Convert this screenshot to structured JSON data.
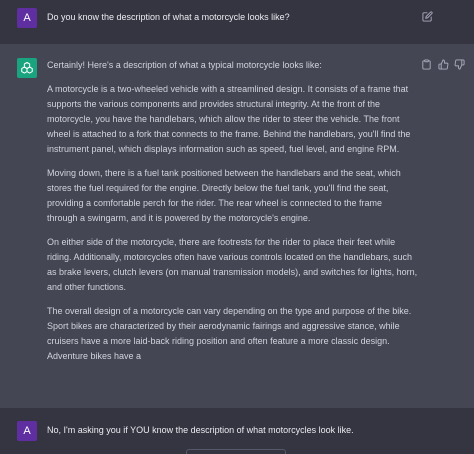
{
  "conversation": {
    "first_user_message": {
      "avatar_letter": "A",
      "text": "Do you know the description of what a motorcycle looks like?",
      "edit_icon": "edit-icon"
    },
    "assistant_message": {
      "avatar_icon": "chatgpt-logo-icon",
      "intro": "Certainly! Here's a description of what a typical motorcycle looks like:",
      "paragraph_1": [
        "A motorcycle is a two-wheeled vehicle with a streamlined design. It consists of a frame that",
        "supports the various components and provides structural integrity. At the front of the",
        "motorcycle, you have the handlebars, which allow the rider to steer the vehicle. The front",
        "wheel is attached to a fork that connects to the frame. Behind the handlebars, you'll find the",
        "instrument panel, which displays information such as speed, fuel level, and engine RPM."
      ],
      "paragraph_2": [
        "Moving down, there is a fuel tank positioned between the handlebars and the seat, which",
        "stores the fuel required for the engine. Directly below the fuel tank, you'll find the seat,",
        "providing a comfortable perch for the rider. The rear wheel is connected to the frame",
        "through a swingarm, and it is powered by the motorcycle's engine."
      ],
      "paragraph_3": [
        "On either side of the motorcycle, there are footrests for the rider to place their feet while",
        "riding. Additionally, motorcycles often have various controls located on the handlebars, such",
        "as brake levers, clutch levers (on manual transmission models), and switches for lights, horn,",
        "and other functions."
      ],
      "paragraph_4": [
        "The overall design of a motorcycle can vary depending on the type and purpose of the bike.",
        "Sport bikes are characterized by their aerodynamic fairings and aggressive stance, while",
        "cruisers have a more laid-back riding position and often feature a more classic design.",
        "Adventure bikes have a"
      ],
      "action_icons": [
        "copy-icon",
        "thumbs-up-icon",
        "thumbs-down-icon"
      ]
    },
    "second_user_message": {
      "avatar_letter": "A",
      "text": "No, I'm asking you if YOU know the description of what motorcycles look like."
    }
  },
  "colors": {
    "background": "#343541",
    "assistant_background": "#444654",
    "user_avatar": "#5f2ea0",
    "assistant_avatar": "#19a37f",
    "text": "#d1d5db"
  }
}
